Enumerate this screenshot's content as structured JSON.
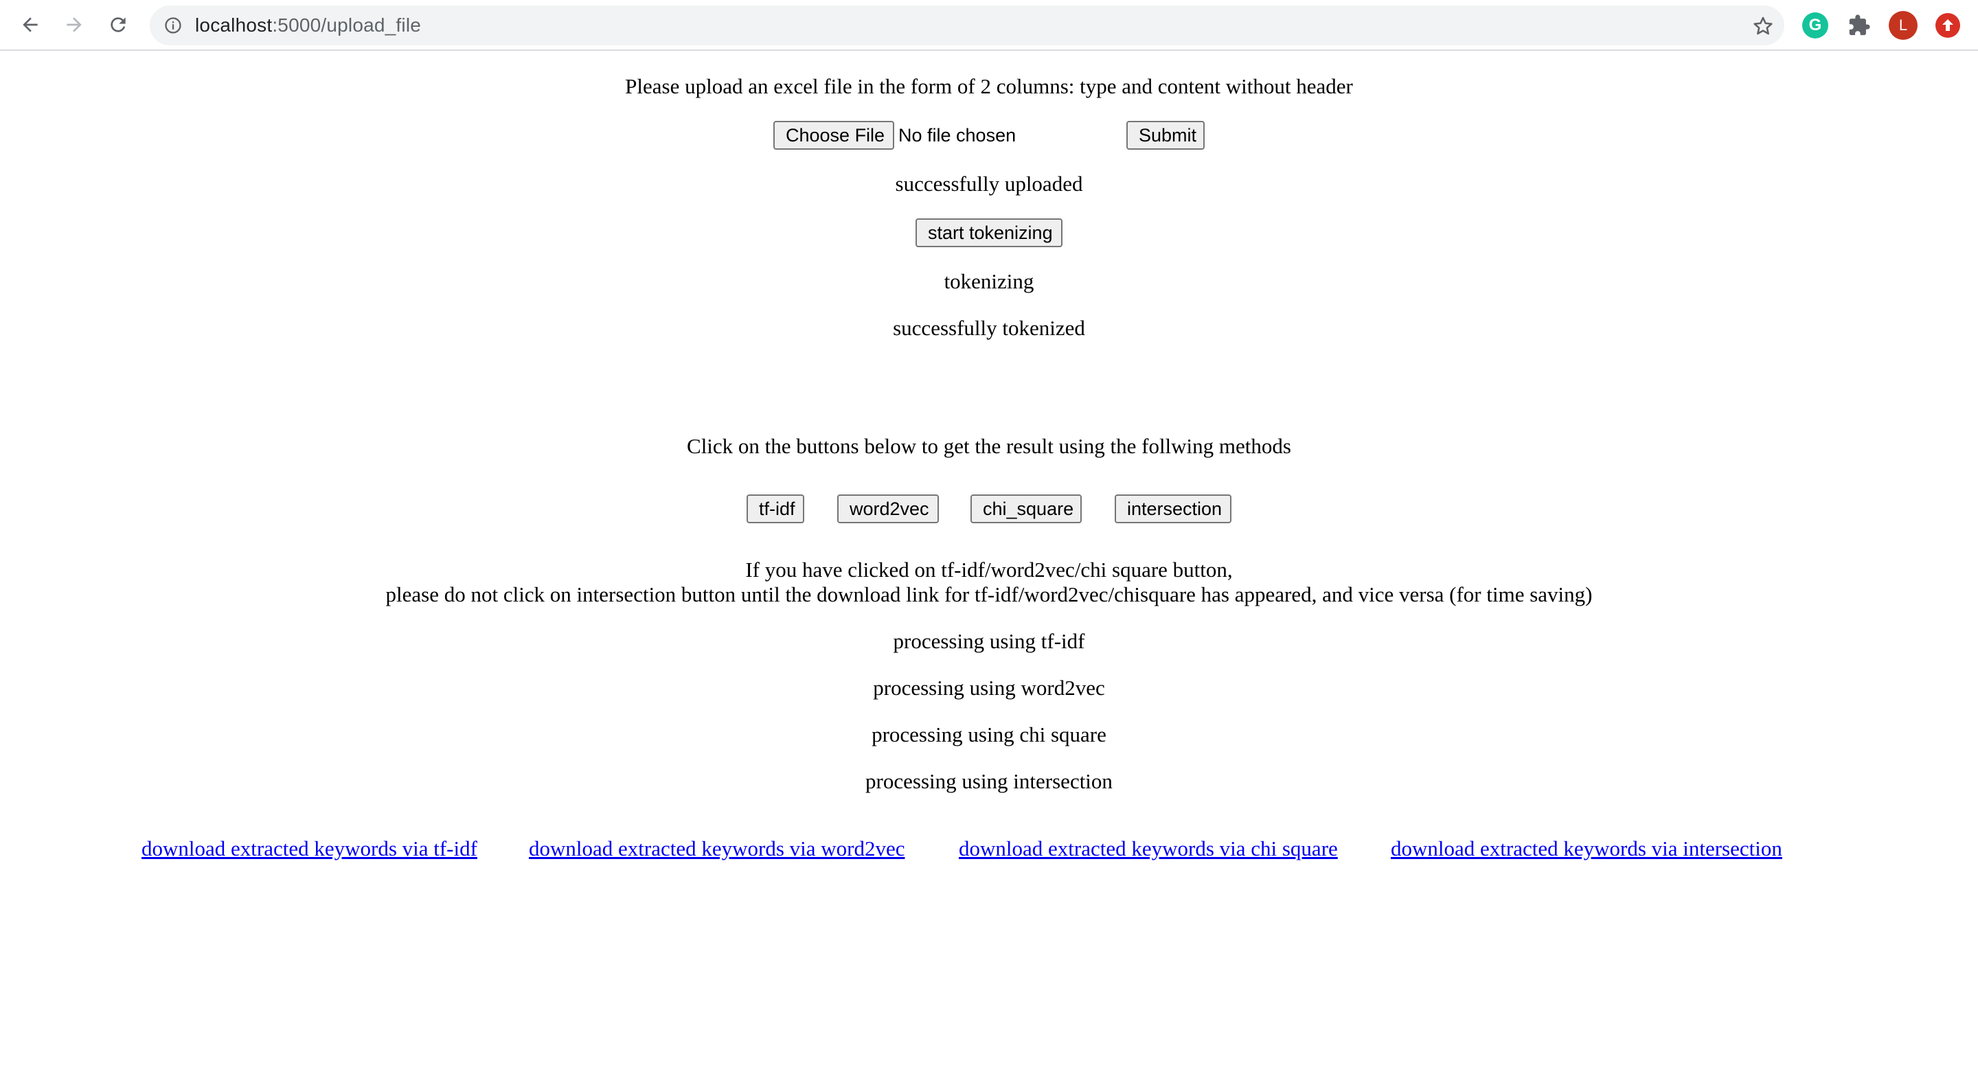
{
  "browser": {
    "url_host": "localhost",
    "url_path": ":5000/upload_file",
    "avatar_letter": "L",
    "grammarly_letter": "G"
  },
  "upload": {
    "instructions": "Please upload an excel file in the form of 2 columns: type and content without header",
    "choose_file_label": "Choose File",
    "no_file_text": "No file chosen",
    "submit_label": "Submit",
    "status": "successfully uploaded"
  },
  "tokenize": {
    "button_label": "start tokenizing",
    "status_running": "tokenizing",
    "status_done": "successfully tokenized"
  },
  "methods": {
    "intro": "Click on the buttons below to get the result using the follwing methods",
    "buttons": [
      {
        "label": "tf-idf"
      },
      {
        "label": "word2vec"
      },
      {
        "label": "chi_square"
      },
      {
        "label": "intersection"
      }
    ],
    "note_line1": "If you have clicked on tf-idf/word2vec/chi square button,",
    "note_line2": "please do not click on intersection button until the download link for tf-idf/word2vec/chisquare has appeared, and vice versa (for time saving)",
    "processing": [
      "processing using tf-idf",
      "processing using word2vec",
      "processing using chi square",
      "processing using intersection"
    ]
  },
  "downloads": [
    {
      "label": "download extracted keywords via tf-idf"
    },
    {
      "label": "download extracted keywords via word2vec"
    },
    {
      "label": "download extracted keywords via chi square"
    },
    {
      "label": "download extracted keywords via intersection"
    }
  ],
  "colors": {
    "link": "#0000ee",
    "button_bg": "#efefef",
    "button_border": "#767676",
    "omnibox_bg": "#f1f3f4",
    "avatar_bg": "#c5341f",
    "grammarly_bg": "#15c39a"
  }
}
